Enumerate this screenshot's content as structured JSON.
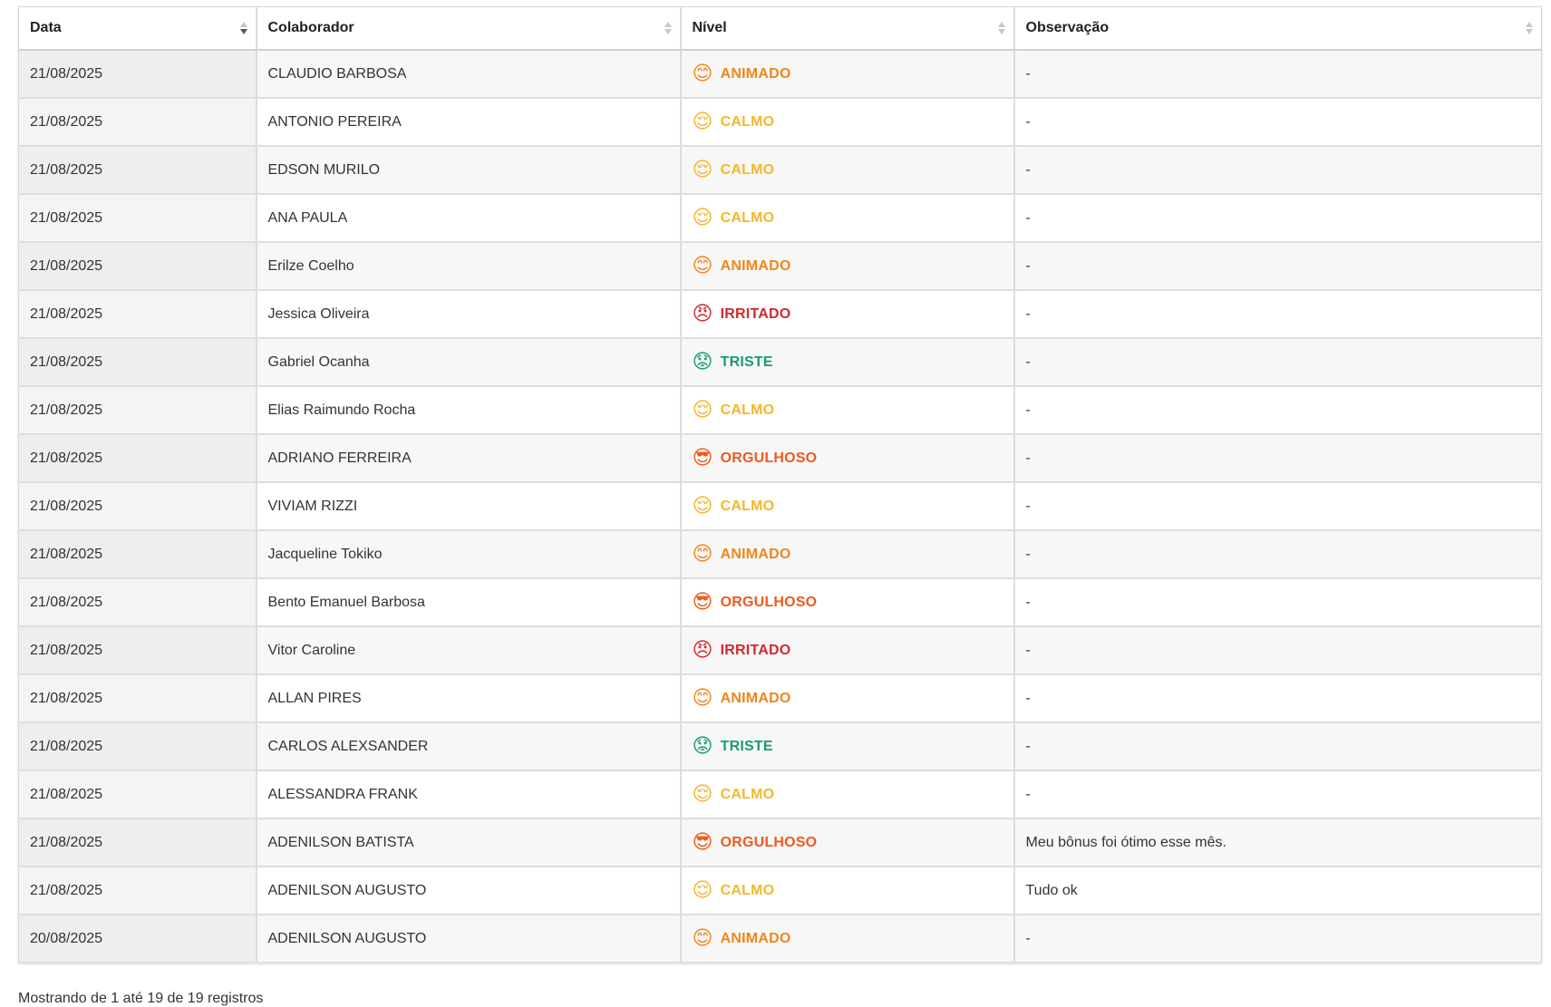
{
  "table": {
    "columns": [
      {
        "label": "Data",
        "sort": "desc"
      },
      {
        "label": "Colaborador",
        "sort": "none"
      },
      {
        "label": "Nível",
        "sort": "none"
      },
      {
        "label": "Observação",
        "sort": "none"
      }
    ],
    "levels": {
      "ANIMADO": {
        "emoji": "😊",
        "icon": "smiling-face-icon",
        "color": "#f0861a"
      },
      "CALMO": {
        "emoji": "😌",
        "icon": "relieved-face-icon",
        "color": "#f6b52c"
      },
      "IRRITADO": {
        "emoji": "😠",
        "icon": "angry-face-icon",
        "color": "#d22a2a"
      },
      "TRISTE": {
        "emoji": "😟",
        "icon": "worried-face-icon",
        "color": "#1a9b77"
      },
      "ORGULHOSO": {
        "emoji": "😎",
        "icon": "sunglasses-face-icon",
        "color": "#ef5a1e"
      }
    },
    "rows": [
      {
        "date": "21/08/2025",
        "name": "CLAUDIO BARBOSA",
        "level": "ANIMADO",
        "obs": "-"
      },
      {
        "date": "21/08/2025",
        "name": "ANTONIO PEREIRA",
        "level": "CALMO",
        "obs": "-"
      },
      {
        "date": "21/08/2025",
        "name": "EDSON MURILO",
        "level": "CALMO",
        "obs": "-"
      },
      {
        "date": "21/08/2025",
        "name": "ANA PAULA",
        "level": "CALMO",
        "obs": "-"
      },
      {
        "date": "21/08/2025",
        "name": "Erilze Coelho",
        "level": "ANIMADO",
        "obs": "-"
      },
      {
        "date": "21/08/2025",
        "name": "Jessica Oliveira",
        "level": "IRRITADO",
        "obs": "-"
      },
      {
        "date": "21/08/2025",
        "name": "Gabriel Ocanha",
        "level": "TRISTE",
        "obs": "-"
      },
      {
        "date": "21/08/2025",
        "name": "Elias Raimundo Rocha",
        "level": "CALMO",
        "obs": "-"
      },
      {
        "date": "21/08/2025",
        "name": "ADRIANO FERREIRA",
        "level": "ORGULHOSO",
        "obs": "-"
      },
      {
        "date": "21/08/2025",
        "name": "VIVIAM RIZZI",
        "level": "CALMO",
        "obs": "-"
      },
      {
        "date": "21/08/2025",
        "name": "Jacqueline Tokiko",
        "level": "ANIMADO",
        "obs": "-"
      },
      {
        "date": "21/08/2025",
        "name": "Bento Emanuel Barbosa",
        "level": "ORGULHOSO",
        "obs": "-"
      },
      {
        "date": "21/08/2025",
        "name": "Vitor Caroline",
        "level": "IRRITADO",
        "obs": "-"
      },
      {
        "date": "21/08/2025",
        "name": "ALLAN PIRES",
        "level": "ANIMADO",
        "obs": "-"
      },
      {
        "date": "21/08/2025",
        "name": "CARLOS ALEXSANDER",
        "level": "TRISTE",
        "obs": "-"
      },
      {
        "date": "21/08/2025",
        "name": "ALESSANDRA FRANK",
        "level": "CALMO",
        "obs": "-"
      },
      {
        "date": "21/08/2025",
        "name": "ADENILSON BATISTA",
        "level": "ORGULHOSO",
        "obs": "Meu bônus foi ótimo esse mês."
      },
      {
        "date": "21/08/2025",
        "name": "ADENILSON AUGUSTO",
        "level": "CALMO",
        "obs": "Tudo ok"
      },
      {
        "date": "20/08/2025",
        "name": "ADENILSON AUGUSTO",
        "level": "ANIMADO",
        "obs": "-"
      }
    ]
  },
  "footer": {
    "info": "Mostrando de 1 até 19 de 19 registros"
  }
}
